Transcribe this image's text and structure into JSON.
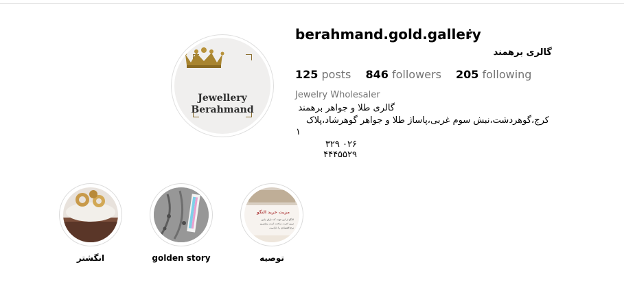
{
  "profile": {
    "username": "berahmand.gold.gallery",
    "full_name": "گالری برهمند",
    "avatar_logo": {
      "line1": "Jewellery",
      "line2": "Berahmand"
    },
    "stats": [
      {
        "count": "125",
        "label": "posts"
      },
      {
        "count": "846",
        "label": "followers"
      },
      {
        "count": "205",
        "label": "following"
      }
    ],
    "category": "Jewelry Wholesaler",
    "bio_lines": [
      "گالری طلا و جواهر برهمند",
      "کرج،گوهردشت،نبش سوم غربی،پاساژ طلا و جواهر گوهرشاد،پلاک",
      "۱",
      "۰۲۶ ۳۲۹ ۴۴۴۵۵۲۹"
    ]
  },
  "highlights": [
    {
      "label": "انگشتر",
      "icon": "ring-highlight-cover"
    },
    {
      "label": "golden story",
      "icon": "chain-highlight-cover"
    },
    {
      "label": "توصیه",
      "icon": "flyer-highlight-cover",
      "cover_text": [
        "مزیت خرید النگو",
        "النگو از این جهت که دارای پایین",
        "ترین اجرت ساخت است بیشترین",
        "نرخ اقتصادی را داراست"
      ]
    }
  ],
  "icons": {
    "options": "more-horizontal-icon"
  },
  "colors": {
    "gold": "#9c7a2c",
    "muted": "#737373",
    "border": "#dbdbdb"
  }
}
